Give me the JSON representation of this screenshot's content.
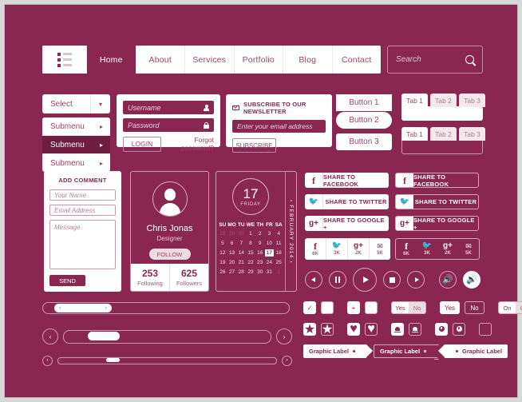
{
  "theme": {
    "bg": "#8a2751",
    "accent": "#ffffff",
    "dark": "#6d1d3f"
  },
  "nav": {
    "menu_icon": "list-icon",
    "items": [
      {
        "label": "Home",
        "active": true
      },
      {
        "label": "About",
        "active": false
      },
      {
        "label": "Services",
        "active": false
      },
      {
        "label": "Portfolio",
        "active": false
      },
      {
        "label": "Blog",
        "active": false
      },
      {
        "label": "Contact",
        "active": false
      }
    ]
  },
  "search": {
    "placeholder": "Search",
    "icon": "search-icon"
  },
  "select": {
    "label": "Select",
    "caret": "▾"
  },
  "submenu": {
    "items": [
      {
        "label": "Submenu",
        "caret": "▸",
        "active": false
      },
      {
        "label": "Submenu",
        "caret": "▸",
        "active": true
      },
      {
        "label": "Submenu",
        "caret": "▸",
        "active": false
      }
    ]
  },
  "login": {
    "username_placeholder": "Username",
    "password_placeholder": "Password",
    "submit_label": "LOGIN",
    "forgot_label": "Forgot password?"
  },
  "newsletter": {
    "heading": "SUBSCRIBE TO OUR NEWSLETTER",
    "email_placeholder": "Enter your email address",
    "button_label": "SUBSCRIBE"
  },
  "buttons": [
    {
      "label": "Button 1",
      "style": "square"
    },
    {
      "label": "Button 2",
      "style": "pill"
    },
    {
      "label": "Button 3",
      "style": "rounded"
    }
  ],
  "tabs": [
    {
      "variant": "filled",
      "items": [
        {
          "label": "Tab 1",
          "active": true
        },
        {
          "label": "Tab 2",
          "active": false
        },
        {
          "label": "Tab 3",
          "active": false
        }
      ]
    },
    {
      "variant": "outlined",
      "items": [
        {
          "label": "Tab 1",
          "active": true
        },
        {
          "label": "Tab 2",
          "active": false
        },
        {
          "label": "Tab 3",
          "active": false
        }
      ]
    }
  ],
  "comment_form": {
    "heading": "ADD COMMENT",
    "name_placeholder": "Your Name",
    "email_placeholder": "Email Address",
    "message_placeholder": "Message",
    "send_label": "SEND"
  },
  "profile": {
    "name": "Chris Jonas",
    "role": "Designer",
    "follow_label": "FOLLOW",
    "stats": [
      {
        "value": "253",
        "caption": "Following"
      },
      {
        "value": "625",
        "caption": "Followers"
      }
    ]
  },
  "calendar": {
    "day_number": "17",
    "day_name": "FRIDAY",
    "month_label": "‹ FEBRUARY 2014 ›",
    "weekday_headers": [
      "SU",
      "MO",
      "TU",
      "WE",
      "TH",
      "FR",
      "SA"
    ],
    "cells": [
      {
        "d": "28",
        "state": "off"
      },
      {
        "d": "29",
        "state": "off"
      },
      {
        "d": "30",
        "state": "off"
      },
      {
        "d": "1",
        "state": "on"
      },
      {
        "d": "2",
        "state": "on"
      },
      {
        "d": "3",
        "state": "on"
      },
      {
        "d": "4",
        "state": "on"
      },
      {
        "d": "5",
        "state": "on"
      },
      {
        "d": "6",
        "state": "on"
      },
      {
        "d": "7",
        "state": "on"
      },
      {
        "d": "8",
        "state": "on"
      },
      {
        "d": "9",
        "state": "on"
      },
      {
        "d": "10",
        "state": "on"
      },
      {
        "d": "11",
        "state": "on"
      },
      {
        "d": "12",
        "state": "on"
      },
      {
        "d": "13",
        "state": "on"
      },
      {
        "d": "14",
        "state": "on"
      },
      {
        "d": "15",
        "state": "on"
      },
      {
        "d": "16",
        "state": "on"
      },
      {
        "d": "17",
        "state": "sel"
      },
      {
        "d": "18",
        "state": "on"
      },
      {
        "d": "19",
        "state": "on"
      },
      {
        "d": "20",
        "state": "on"
      },
      {
        "d": "21",
        "state": "on"
      },
      {
        "d": "22",
        "state": "on"
      },
      {
        "d": "23",
        "state": "on"
      },
      {
        "d": "24",
        "state": "on"
      },
      {
        "d": "25",
        "state": "on"
      },
      {
        "d": "26",
        "state": "on"
      },
      {
        "d": "27",
        "state": "on"
      },
      {
        "d": "28",
        "state": "on"
      },
      {
        "d": "29",
        "state": "on"
      },
      {
        "d": "30",
        "state": "on"
      },
      {
        "d": "31",
        "state": "on"
      },
      {
        "d": "1",
        "state": "off"
      }
    ]
  },
  "share": {
    "column_solid": [
      {
        "label": "SHARE TO FACEBOOK",
        "icon": "facebook-icon",
        "glyph": "f"
      },
      {
        "label": "SHARE TO TWITTER",
        "icon": "twitter-icon",
        "glyph": "🐦"
      },
      {
        "label": "SHARE TO GOOGLE +",
        "icon": "googleplus-icon",
        "glyph": "g+"
      }
    ],
    "column_outline": [
      {
        "label": "SHARE TO FACEBOOK",
        "icon": "facebook-icon",
        "glyph": "f"
      },
      {
        "label": "SHARE TO TWITTER",
        "icon": "twitter-icon",
        "glyph": "🐦"
      },
      {
        "label": "SHARE TO GOOGLE +",
        "icon": "googleplus-icon",
        "glyph": "g+"
      }
    ]
  },
  "counters": {
    "solid": [
      {
        "icon": "facebook-icon",
        "glyph": "f",
        "count": "6K"
      },
      {
        "icon": "twitter-icon",
        "glyph": "🐦",
        "count": "3K"
      },
      {
        "icon": "googleplus-icon",
        "glyph": "g+",
        "count": "2K"
      },
      {
        "icon": "mail-icon",
        "glyph": "✉",
        "count": "5K"
      }
    ],
    "outline": [
      {
        "icon": "facebook-icon",
        "glyph": "f",
        "count": "6K"
      },
      {
        "icon": "twitter-icon",
        "glyph": "🐦",
        "count": "3K"
      },
      {
        "icon": "googleplus-icon",
        "glyph": "g+",
        "count": "2K"
      },
      {
        "icon": "mail-icon",
        "glyph": "✉",
        "count": "5K"
      }
    ]
  },
  "media": {
    "controls": [
      {
        "name": "rewind-button"
      },
      {
        "name": "pause-button"
      },
      {
        "name": "play-button"
      },
      {
        "name": "stop-button"
      },
      {
        "name": "forward-button"
      },
      {
        "name": "volume-button-outline"
      },
      {
        "name": "volume-button-filled"
      }
    ]
  },
  "sliders": {
    "scrollbar_left_chevron": "‹",
    "scrollbar_right_chevron": "›",
    "arrow_left": "‹",
    "arrow_right": "›",
    "tiny_left": "‹",
    "tiny_right": "›"
  },
  "toggles": [
    {
      "name": "check-toggle",
      "glyph": "✓",
      "state": "on"
    },
    {
      "name": "close-toggle",
      "glyph": "✕",
      "state": "off"
    },
    {
      "name": "plus-toggle",
      "glyph": "+",
      "state": "on"
    },
    {
      "name": "minus-toggle",
      "glyph": "−",
      "state": "off"
    }
  ],
  "yesno_pair": {
    "on_label": "Yes",
    "off_label": "No"
  },
  "yesno_split": {
    "on_label": "Yes",
    "off_label": "No"
  },
  "onoff_pair": {
    "on_label": "On",
    "off_label": "Off"
  },
  "icon_toggles": [
    {
      "name": "star-icon",
      "glyph": "★",
      "state": "on"
    },
    {
      "name": "star-icon",
      "glyph": "★",
      "state": "off"
    },
    {
      "name": "heart-icon",
      "glyph": "♥",
      "state": "on"
    },
    {
      "name": "heart-icon",
      "glyph": "♥",
      "state": "off"
    },
    {
      "name": "bell-icon",
      "glyph": "",
      "state": "on"
    },
    {
      "name": "bell-icon",
      "glyph": "",
      "state": "off"
    },
    {
      "name": "pin-icon",
      "glyph": "",
      "state": "on"
    },
    {
      "name": "pin-icon",
      "glyph": "",
      "state": "off"
    },
    {
      "name": "empty-checkbox",
      "glyph": "",
      "state": "empty"
    }
  ],
  "graphic_labels": [
    {
      "text": "Graphic Label",
      "style": "filled-right-arrow"
    },
    {
      "text": "Graphic Label",
      "style": "outline-right-arrow"
    },
    {
      "text": "Graphic Label",
      "style": "filled-left-arrow"
    }
  ]
}
